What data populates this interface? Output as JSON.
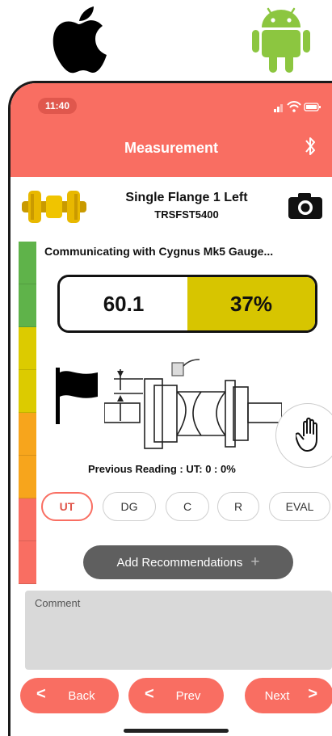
{
  "status_bar": {
    "time": "11:40"
  },
  "header": {
    "title": "Measurement"
  },
  "part": {
    "name": "Single Flange 1 Left",
    "code": "TRSFST5400"
  },
  "gauge": {
    "status": "Communicating with Cygnus Mk5 Gauge...",
    "reading_value": "60.1",
    "reading_percent": "37%",
    "percent_color": "#d7c500"
  },
  "wear_scale": [
    "#5fb34a",
    "#5fb34a",
    "#dccb00",
    "#dccb00",
    "#f7a51c",
    "#f7a51c",
    "#f96e62",
    "#f96e62"
  ],
  "previous_reading": "Previous Reading :  UT: 0   : 0%",
  "modes": [
    {
      "label": "UT",
      "active": true
    },
    {
      "label": "DG",
      "active": false
    },
    {
      "label": "C",
      "active": false
    },
    {
      "label": "R",
      "active": false
    },
    {
      "label": "EVAL",
      "active": false
    }
  ],
  "recommendations": {
    "label": "Add Recommendations",
    "plus": "+"
  },
  "comment": {
    "label": "Comment"
  },
  "nav": {
    "back": "Back",
    "prev": "Prev",
    "next": "Next",
    "chev_left": "<",
    "chev_right": ">"
  },
  "colors": {
    "accent": "#f96e62",
    "dark_button": "#5f5f5f",
    "comment_bg": "#d9d9d9"
  }
}
